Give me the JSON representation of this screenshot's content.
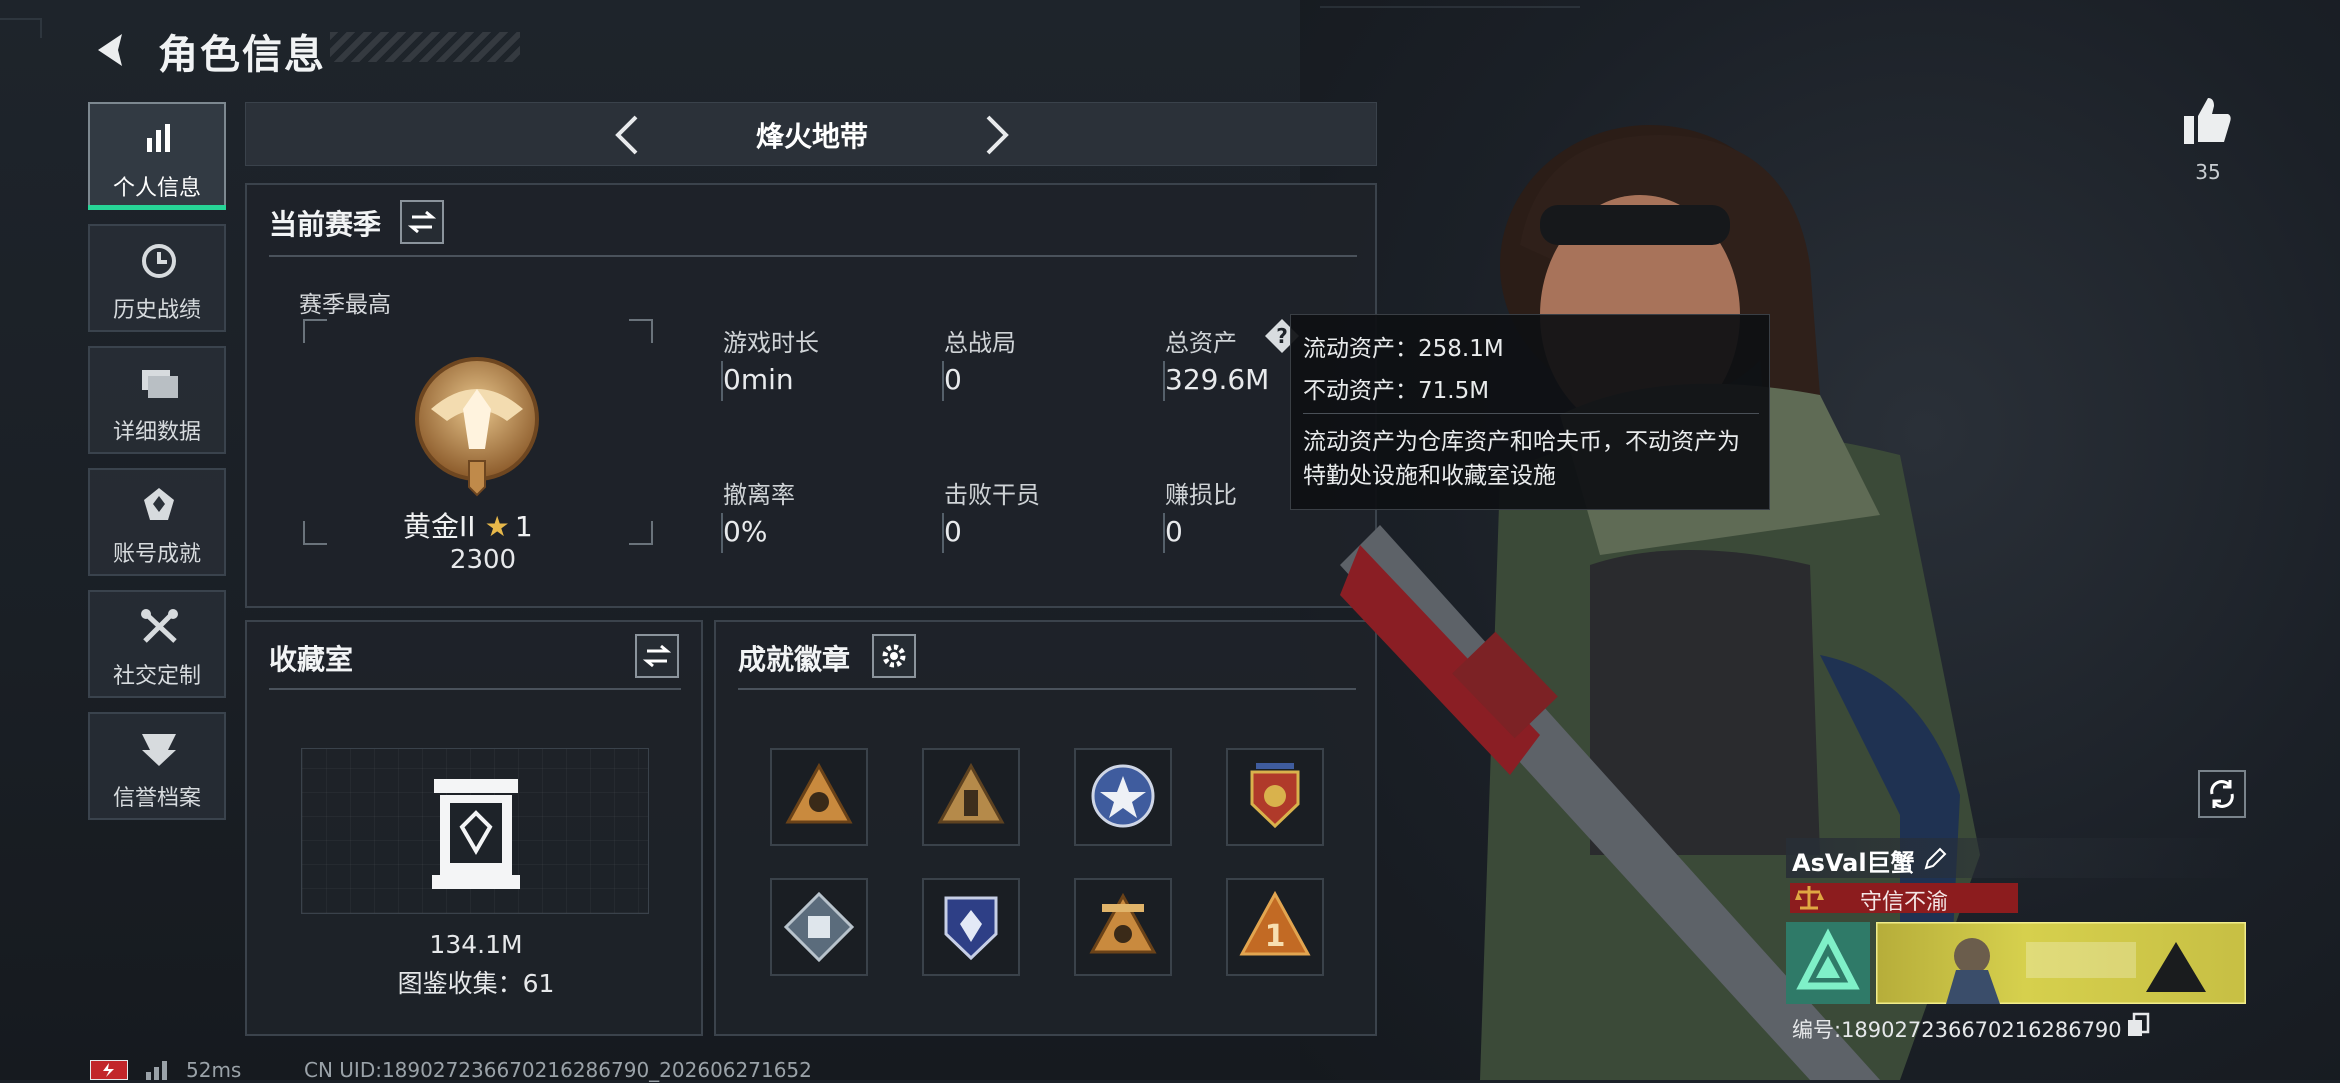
{
  "header": {
    "title": "角色信息"
  },
  "sidebar": {
    "items": [
      {
        "label": "个人信息",
        "icon": "bar-chart-icon",
        "active": true
      },
      {
        "label": "历史战绩",
        "icon": "clock-icon",
        "active": false
      },
      {
        "label": "详细数据",
        "icon": "folders-icon",
        "active": false
      },
      {
        "label": "账号成就",
        "icon": "achievement-icon",
        "active": false
      },
      {
        "label": "社交定制",
        "icon": "tools-icon",
        "active": false
      },
      {
        "label": "信誉档案",
        "icon": "credit-icon",
        "active": false
      }
    ]
  },
  "mode": {
    "title": "烽火地带"
  },
  "season": {
    "title": "当前赛季",
    "best_label": "赛季最高",
    "rank_name": "黄金II",
    "rank_stars": "1",
    "rank_score": "2300",
    "stats": [
      {
        "label": "游戏时长",
        "value": "0min"
      },
      {
        "label": "总战局",
        "value": "0"
      },
      {
        "label": "总资产",
        "value": "329.6M"
      },
      {
        "label": "撤离率",
        "value": "0%"
      },
      {
        "label": "击败干员",
        "value": "0"
      },
      {
        "label": "赚损比",
        "value": "0"
      }
    ]
  },
  "tooltip": {
    "liquid": "流动资产：258.1M",
    "fixed": "不动资产：71.5M",
    "description": "流动资产为仓库资产和哈夫币，不动资产为特勤处设施和收藏室设施"
  },
  "collection": {
    "title": "收藏室",
    "value": "134.1M",
    "catalog": "图鉴收集：61"
  },
  "achievements": {
    "title": "成就徽章",
    "badges": [
      "hand-triangle-icon",
      "soldier-triangle-icon",
      "star-shield-icon",
      "eagle-shield-icon",
      "cube-diamond-icon",
      "crystal-shield-icon",
      "skull-triangle-icon",
      "number-one-triangle-icon"
    ]
  },
  "likes": {
    "count": "35"
  },
  "player": {
    "name": "AsVal巨蟹",
    "motto": "守信不渝",
    "uid": "编号:18902723667021628​6790"
  },
  "footer": {
    "ping": "52ms",
    "uid_line": "CN UID:18902723667021628​6790_202606271652"
  },
  "colors": {
    "accent": "#27d597",
    "motto": "#8c1c1e",
    "banner": "#d6d04d"
  }
}
